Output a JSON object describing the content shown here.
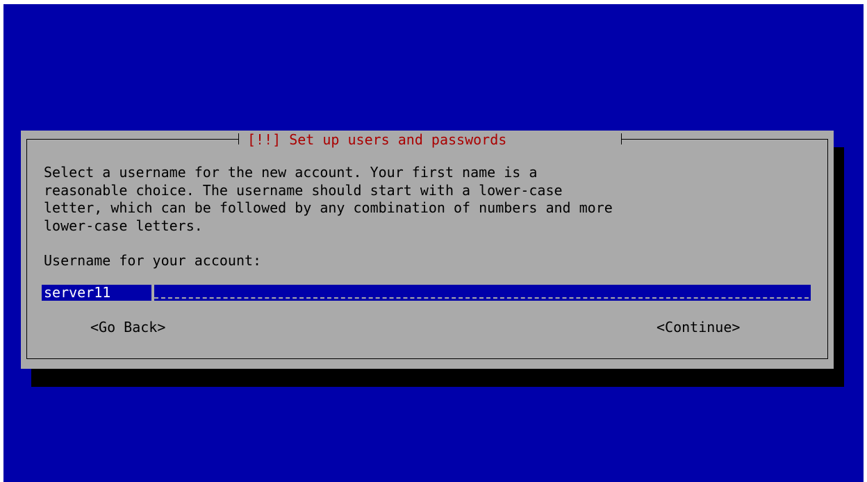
{
  "dialog": {
    "title": "[!!] Set up users and passwords",
    "description_lines": [
      "Select a username for the new account. Your first name is a",
      "reasonable choice. The username should start with a lower-case",
      "letter, which can be followed by any combination of numbers and more",
      "lower-case letters."
    ],
    "prompt": "Username for your account:",
    "username_value": "server11",
    "buttons": {
      "back": "<Go Back>",
      "continue": "<Continue>"
    }
  },
  "colors": {
    "background": "#0000aa",
    "dialog": "#aaaaaa",
    "title": "#aa0000",
    "field": "#0000aa",
    "shadow": "#000000"
  }
}
